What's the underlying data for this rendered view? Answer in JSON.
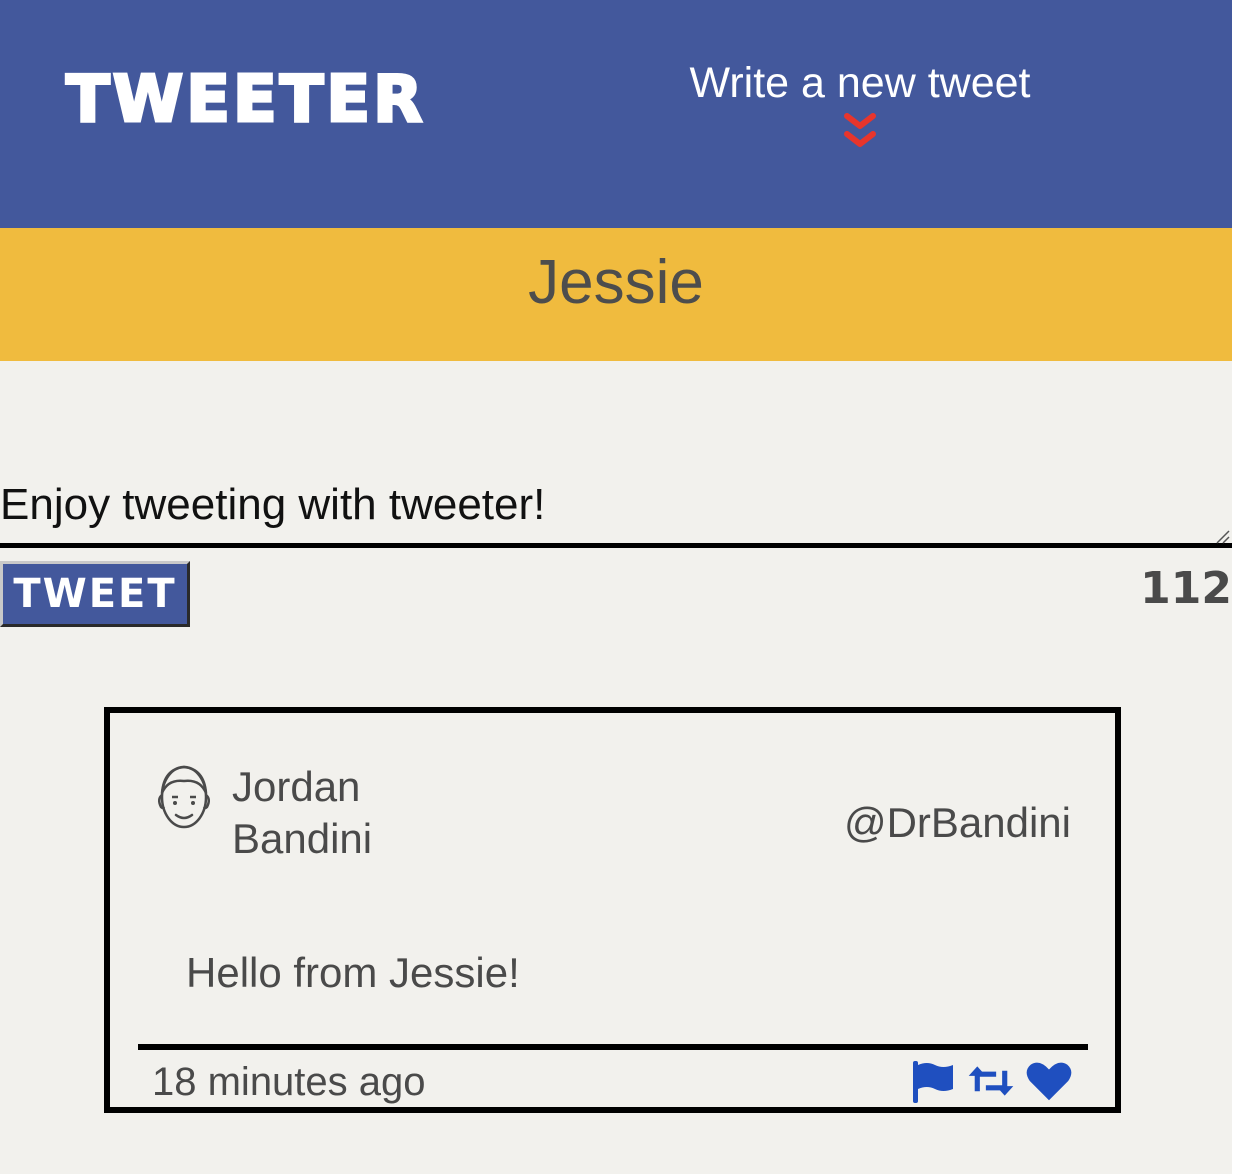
{
  "header": {
    "logo_text": "TWEETER",
    "compose_toggle_label": "Write a new tweet",
    "toggle_icon": "double-chevron-down-icon",
    "background_color": "#43589c",
    "accent_color": "#e8352c"
  },
  "profile": {
    "name": "Jessie",
    "band_color": "#f0bb3e"
  },
  "compose": {
    "text": "Enjoy tweeting with tweeter!",
    "submit_label": "TWEET",
    "char_counter": "112"
  },
  "tweets": [
    {
      "author_name": "Jordan Bandini",
      "handle": "@DrBandini",
      "body": "Hello from Jessie!",
      "time": "18 minutes ago",
      "avatar_icon": "face-avatar-icon",
      "actions": [
        {
          "name": "flag-icon"
        },
        {
          "name": "retweet-icon"
        },
        {
          "name": "heart-icon"
        }
      ],
      "action_color": "#1f4fbf"
    }
  ]
}
